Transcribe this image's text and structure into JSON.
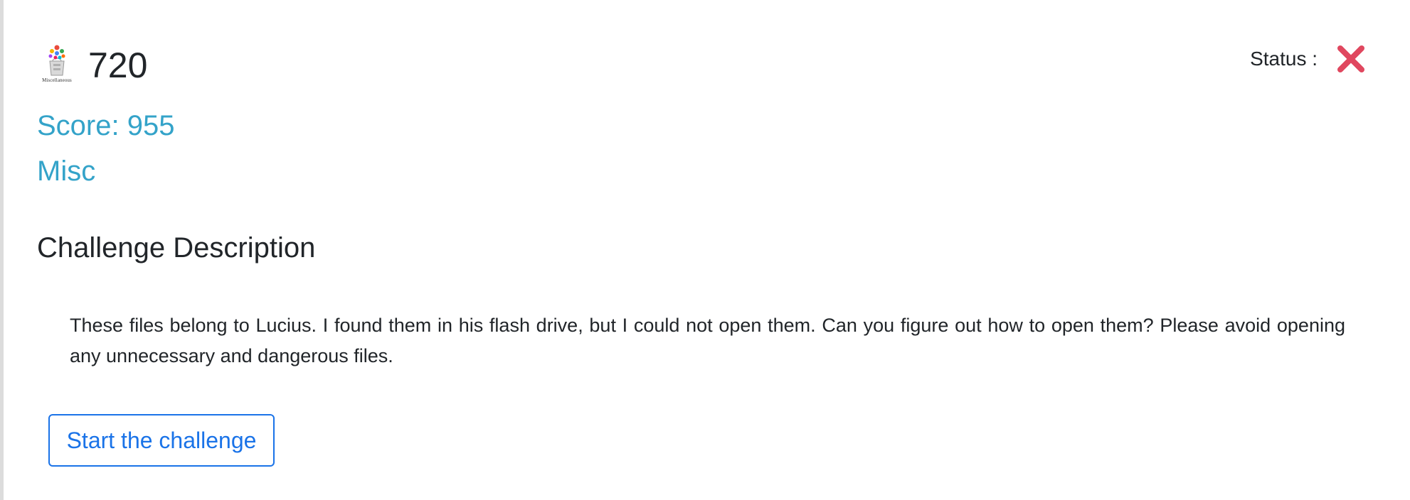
{
  "challenge": {
    "number": "720",
    "category_icon": "miscellaneous-category-icon",
    "category_icon_caption": "Miscellaneous",
    "score_text": "Score: 955",
    "category": "Misc"
  },
  "status": {
    "label": "Status :",
    "icon": "close-x-icon",
    "color": "#e0475f"
  },
  "description": {
    "heading": "Challenge Description",
    "body": "These files belong to Lucius. I found them in his flash drive, but I could not open them. Can you figure out how to open them? Please avoid opening any unnecessary and dangerous files."
  },
  "actions": {
    "start_label": "Start the challenge"
  },
  "colors": {
    "accent_teal": "#34a3c9",
    "button_blue": "#1a73e8",
    "text_dark": "#212529"
  }
}
